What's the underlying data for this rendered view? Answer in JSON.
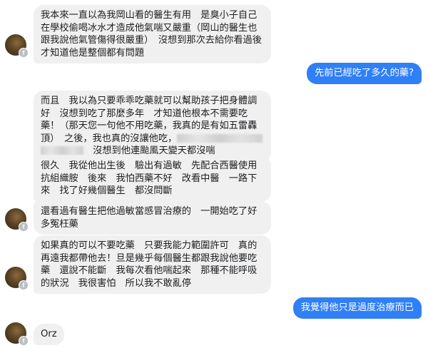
{
  "conversation": {
    "messages": [
      {
        "sender": "them",
        "text": "我本來一直以為我岡山看的醫生有用　是臭小子自己在學校偷喝冰水才造成他氣喘又嚴重（岡山的醫生也跟我說他氣管傷得很嚴重）　沒想到那次去給你看過後　才知道他是整個都有問題"
      },
      {
        "sender": "me",
        "text": "先前已經吃了多久的藥?"
      },
      {
        "sender": "them",
        "text_a": "而且　我以為只要乖乖吃藥就可以幫助孩子把身體調好　沒想到吃了那麼多年　才知道他根本不需要吃藥！（那天您一句他不用吃藥，我真的是有如五雷轟頂）　之後，我也真的沒讓他吃，",
        "text_b": "　沒想到他連颱風天變天都沒喘"
      },
      {
        "sender": "them",
        "text": "很久　我從他出生後　驗出有過敏　先配合西醫使用抗組織胺　後來　我怕西藥不好　改看中醫　一路下來　找了好幾個醫生　都沒問斷"
      },
      {
        "sender": "them",
        "text": "還看過有醫生把他過敏當感冒治療的　一開始吃了好多冤枉藥"
      },
      {
        "sender": "them",
        "text": "如果真的可以不要吃藥　只要我能力範圍許可　真的再遠我都帶他去！旦是幾乎每個醫生都跟我說他要吃藥　還說不能斷　我每次看他喘起來　那種不能呼吸的狀況　我很害怕　所以我不敢亂停"
      },
      {
        "sender": "me",
        "text": "我覺得他只是過度治療而已"
      },
      {
        "sender": "them",
        "text": "Orz"
      }
    ]
  },
  "icons": {
    "avatar": "user-avatar-icon",
    "badge": "facebook-badge-icon",
    "badge_glyph": "f"
  },
  "colors": {
    "incoming_bubble": "#f1f0f0",
    "outgoing_bubble": "#2f7ff7",
    "text": "#1c1e21"
  }
}
